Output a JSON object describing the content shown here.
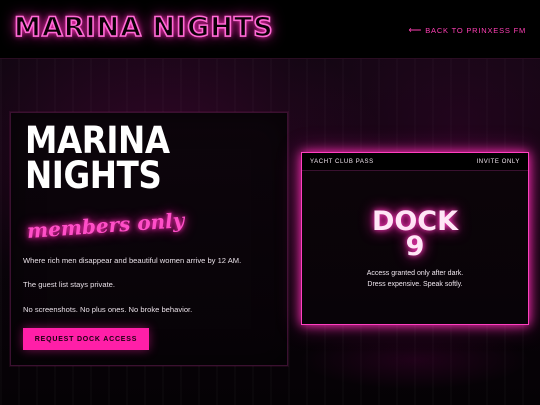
{
  "header": {
    "brand": "MARINA NIGHTS",
    "back_arrow": "⟵",
    "back_link": "BACK TO PRINXESS FM"
  },
  "main_card": {
    "title": "MARINA\nNIGHTS",
    "neon_subtitle": "members only",
    "paragraphs": [
      "Where rich men disappear and beautiful women arrive by 12 AM.",
      "The guest list stays private.",
      "No screenshots. No plus ones. No broke behavior."
    ],
    "cta_label": "REQUEST DOCK ACCESS"
  },
  "pass": {
    "label": "YACHT CLUB PASS",
    "status": "INVITE ONLY",
    "dock": "DOCK\n9",
    "notes": [
      "Access granted only after dark.",
      "Dress expensive. Speak softly."
    ]
  },
  "colors": {
    "accent": "#ff1fa8",
    "neon": "#ff4fc8",
    "background": "#050205"
  }
}
